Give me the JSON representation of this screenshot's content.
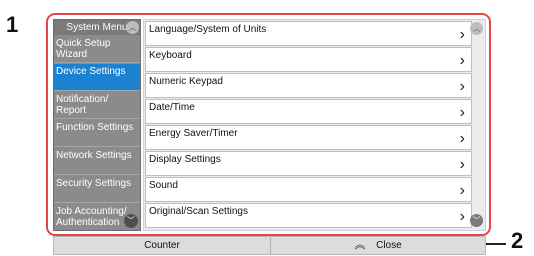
{
  "callouts": {
    "one": "1",
    "two": "2"
  },
  "sidebar": {
    "title": "System Menu",
    "items": [
      {
        "label": "Quick Setup Wizard",
        "active": false
      },
      {
        "label": "Device Settings",
        "active": true
      },
      {
        "label": "Notification/ Report",
        "active": false
      },
      {
        "label": "Function Settings",
        "active": false
      },
      {
        "label": "Network Settings",
        "active": false
      },
      {
        "label": "Security Settings",
        "active": false
      },
      {
        "label": "Job Accounting/ Authentication",
        "active": false
      }
    ]
  },
  "settings_list": {
    "items": [
      {
        "label": "Language/System of Units"
      },
      {
        "label": "Keyboard"
      },
      {
        "label": "Numeric Keypad"
      },
      {
        "label": "Date/Time"
      },
      {
        "label": "Energy Saver/Timer"
      },
      {
        "label": "Display Settings"
      },
      {
        "label": "Sound"
      },
      {
        "label": "Original/Scan Settings"
      }
    ]
  },
  "bottom_bar": {
    "counter_label": "Counter",
    "close_label": "Close"
  },
  "icons": {
    "up": "chevron-up-icon",
    "down": "chevron-down-icon",
    "row": "chevron-right-icon",
    "close": "double-chevron-up-icon"
  },
  "colors": {
    "frame": "#e04848",
    "sidebar_bg": "#8b8b8b",
    "active_item": "#1b82d1"
  }
}
